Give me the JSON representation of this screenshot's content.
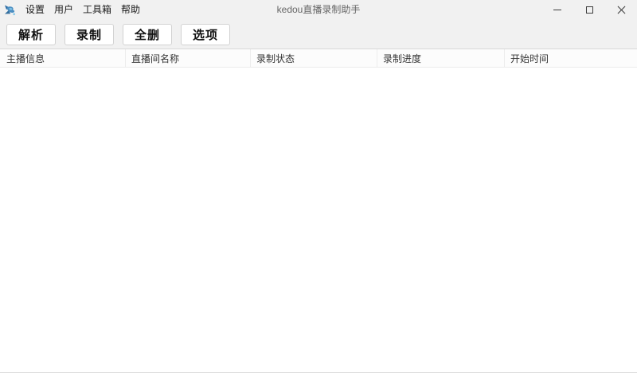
{
  "window": {
    "title": "kedou直播录制助手"
  },
  "menu": {
    "items": [
      {
        "label": "设置"
      },
      {
        "label": "用户"
      },
      {
        "label": "工具箱"
      },
      {
        "label": "帮助"
      }
    ]
  },
  "toolbar": {
    "buttons": [
      {
        "label": "解析"
      },
      {
        "label": "录制"
      },
      {
        "label": "全删"
      },
      {
        "label": "选项"
      }
    ]
  },
  "table": {
    "columns": [
      {
        "label": "主播信息"
      },
      {
        "label": "直播间名称"
      },
      {
        "label": "录制状态"
      },
      {
        "label": "录制进度"
      },
      {
        "label": "开始时间"
      }
    ],
    "rows": []
  },
  "icons": {
    "app_logo": "kedou-tadpole-logo-icon",
    "minimize": "minimize-icon",
    "maximize": "maximize-icon",
    "close": "close-icon"
  },
  "colors": {
    "chrome_bg": "#f1f1f1",
    "toolbar_divider": "#d9d9d9",
    "header_divider": "#ececec",
    "button_border": "#d2d2d2",
    "title_text": "#666666",
    "logo_blue_dark": "#2e6ca4",
    "logo_blue_mid": "#4a8ec2",
    "logo_blue_light": "#7fc0e4"
  }
}
